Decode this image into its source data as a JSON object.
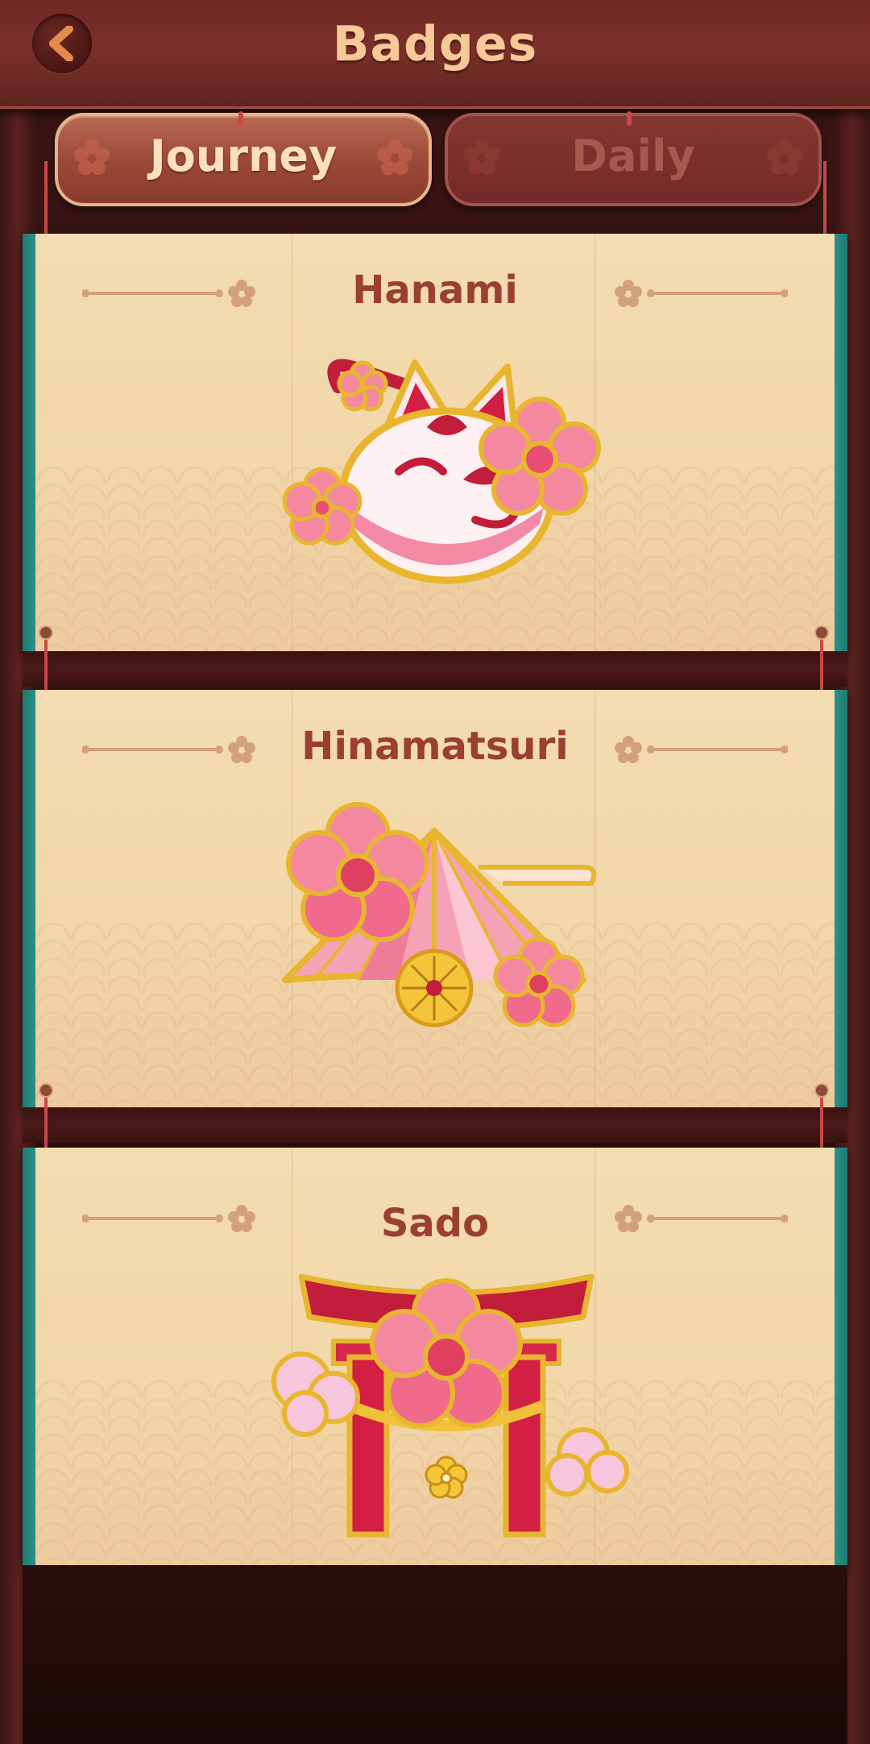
{
  "header": {
    "title": "Badges",
    "back_icon": "chevron-left-icon"
  },
  "tabs": [
    {
      "label": "Journey",
      "active": true
    },
    {
      "label": "Daily",
      "active": false
    }
  ],
  "badges": [
    {
      "title": "Hanami",
      "icon": "kitsune-mask-sakura-badge"
    },
    {
      "title": "Hinamatsuri",
      "icon": "folding-fan-sakura-badge"
    },
    {
      "title": "Sado",
      "icon": "torii-gate-sakura-badge"
    }
  ],
  "colors": {
    "title": "#f7c999",
    "card_title": "#9a4033",
    "accent_teal": "#1d7a72",
    "sakura_pink": "#f07a9a",
    "gold": "#e7b62e"
  }
}
